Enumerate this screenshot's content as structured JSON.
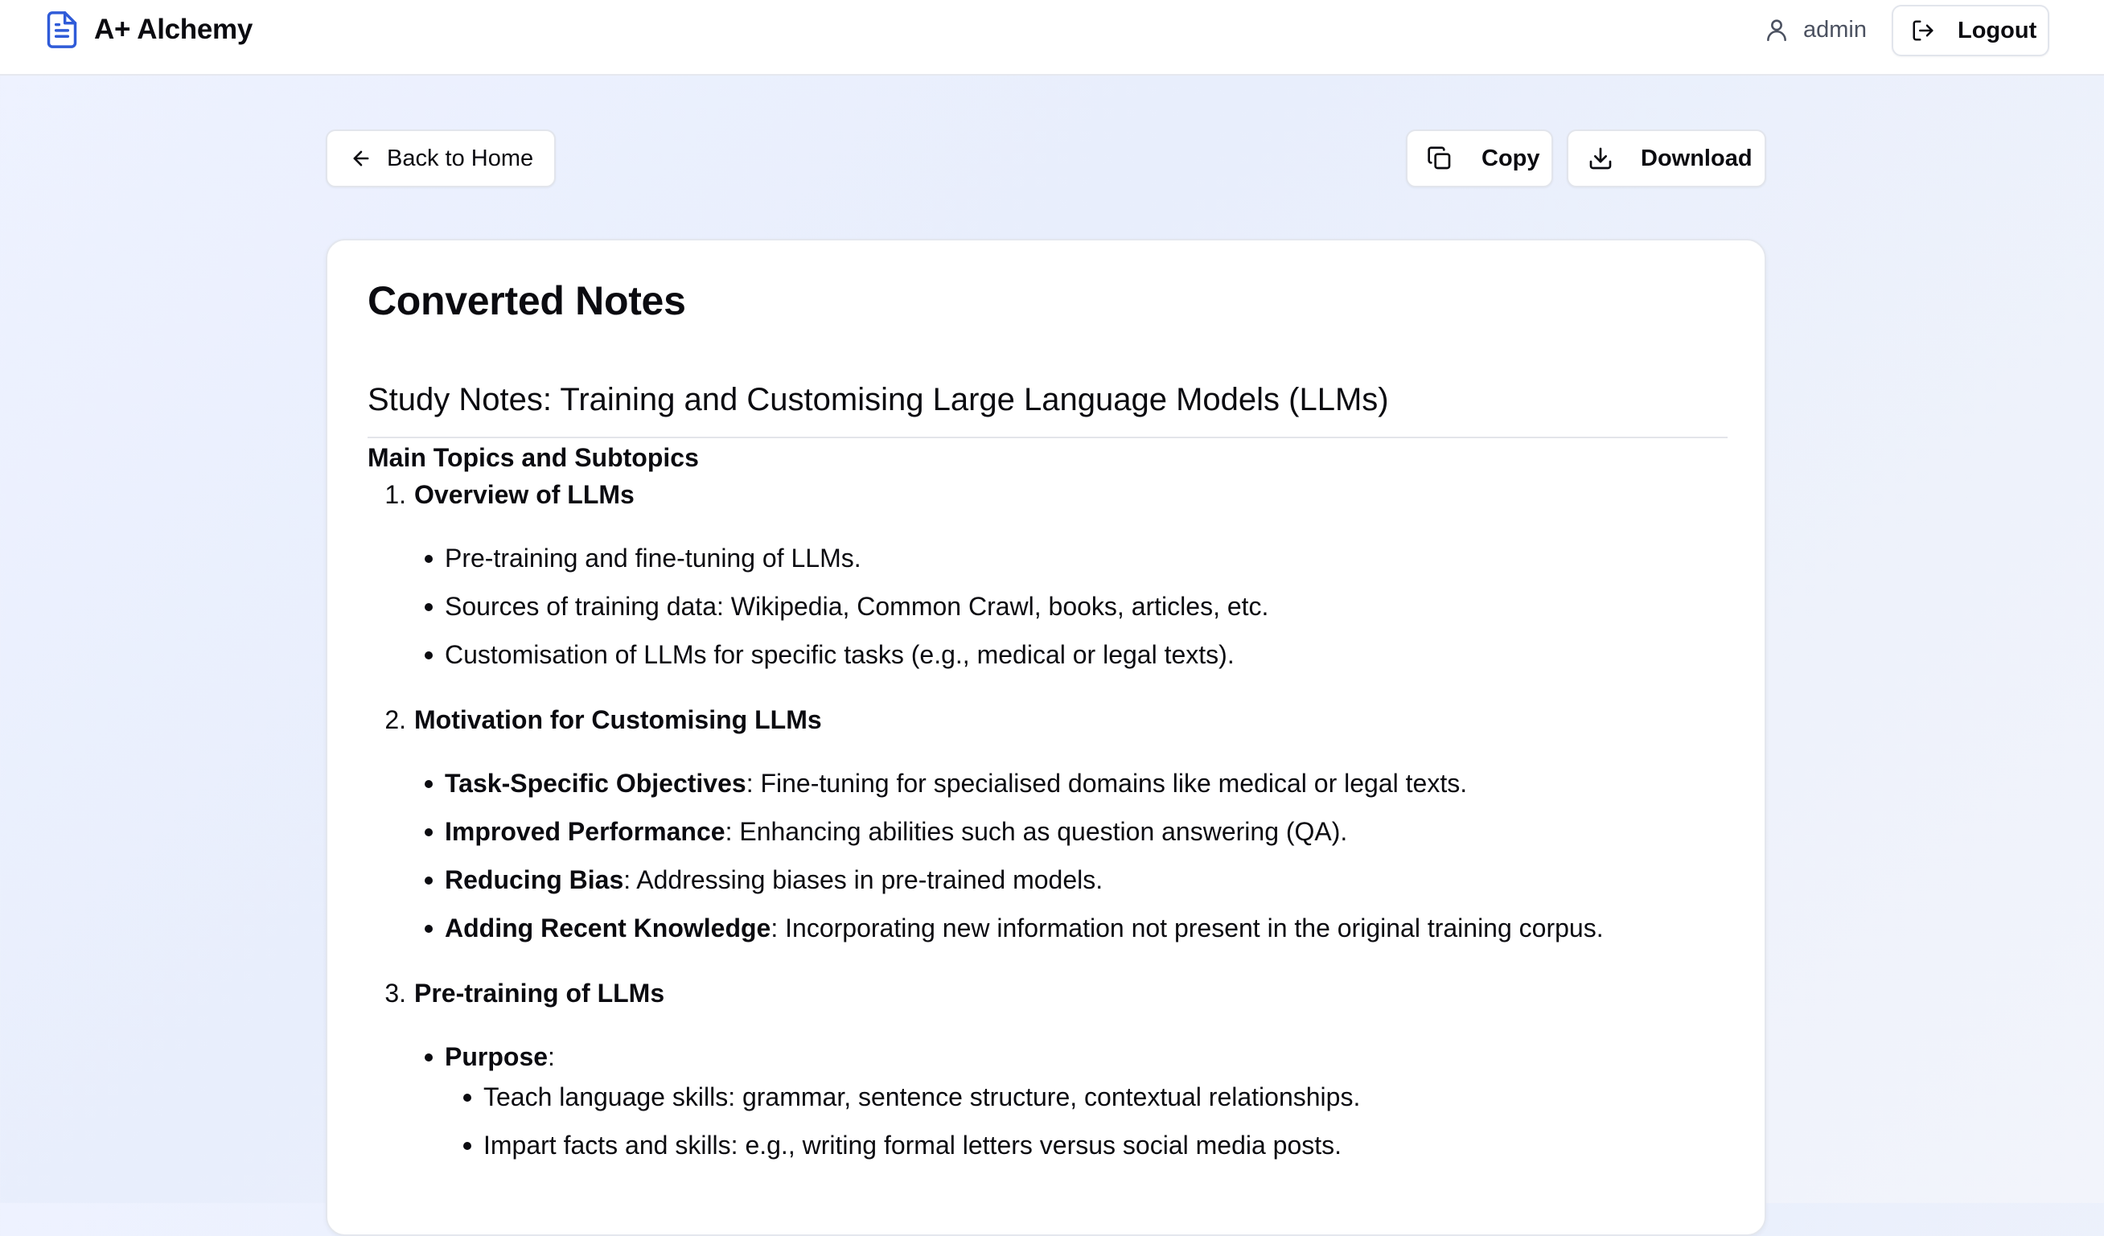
{
  "header": {
    "app_name": "A+ Alchemy",
    "logo_icon": "document-icon",
    "username": "admin",
    "user_icon": "user-icon",
    "logout_label": "Logout",
    "logout_icon": "logout-icon"
  },
  "toolbar": {
    "back_label": "Back to Home",
    "back_icon": "arrow-left-icon",
    "copy_label": "Copy",
    "copy_icon": "copy-icon",
    "download_label": "Download",
    "download_icon": "download-icon"
  },
  "card": {
    "title": "Converted Notes",
    "doc_title": "Study Notes: Training and Customising Large Language Models (LLMs)",
    "section_heading": "Main Topics and Subtopics",
    "topics": [
      {
        "number": "1.",
        "title": "Overview of LLMs",
        "bullets": [
          {
            "term": "",
            "text": "Pre-training and fine-tuning of LLMs."
          },
          {
            "term": "",
            "text": "Sources of training data: Wikipedia, Common Crawl, books, articles, etc."
          },
          {
            "term": "",
            "text": "Customisation of LLMs for specific tasks (e.g., medical or legal texts)."
          }
        ]
      },
      {
        "number": "2.",
        "title": "Motivation for Customising LLMs",
        "bullets": [
          {
            "term": "Task-Specific Objectives",
            "text": ": Fine-tuning for specialised domains like medical or legal texts."
          },
          {
            "term": "Improved Performance",
            "text": ": Enhancing abilities such as question answering (QA)."
          },
          {
            "term": "Reducing Bias",
            "text": ": Addressing biases in pre-trained models."
          },
          {
            "term": "Adding Recent Knowledge",
            "text": ": Incorporating new information not present in the original training corpus."
          }
        ]
      },
      {
        "number": "3.",
        "title": "Pre-training of LLMs",
        "bullets": [
          {
            "term": "Purpose",
            "text": ":"
          }
        ],
        "sub_bullets": [
          "Teach language skills: grammar, sentence structure, contextual relationships.",
          "Impart facts and skills: e.g., writing formal letters versus social media posts."
        ]
      }
    ]
  }
}
